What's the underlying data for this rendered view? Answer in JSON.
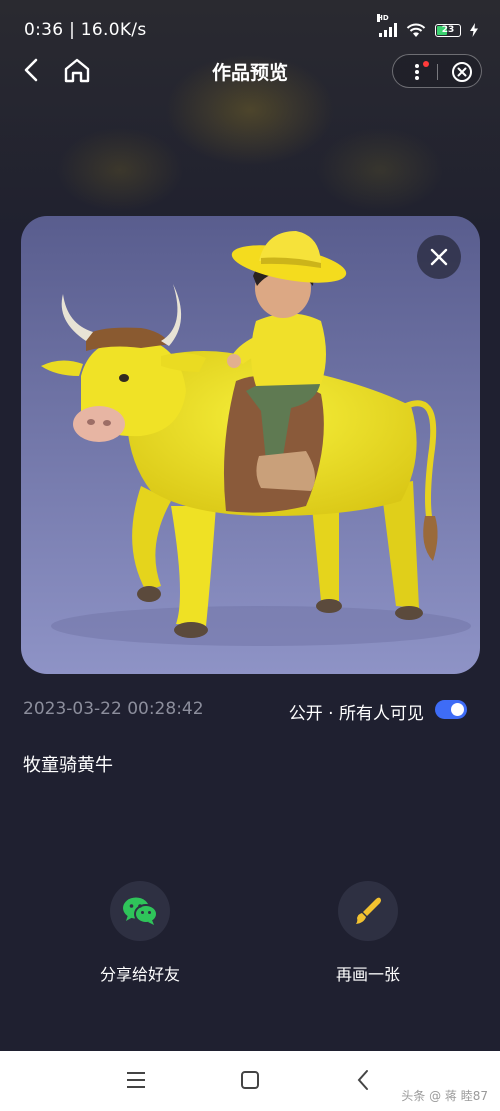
{
  "status_bar": {
    "time_speed": "0:36 | 16.0K/s",
    "signal_label": "HD",
    "battery": "23"
  },
  "header": {
    "title": "作品预览",
    "back_icon": "chevron-left-icon",
    "home_icon": "home-icon",
    "more_icon": "more-vertical-icon",
    "close_icon": "close-circle-icon"
  },
  "artwork": {
    "close_icon": "close-icon"
  },
  "meta": {
    "created_at": "2023-03-22 00:28:42",
    "visibility_label": "公开 · 所有人可见",
    "visibility_enabled": true,
    "toggle_color": "#3e6cf6"
  },
  "prompt_text": "牧童骑黄牛",
  "actions": {
    "share_label": "分享给好友",
    "share_icon": "wechat-icon",
    "share_icon_color": "#2fc45a",
    "redraw_label": "再画一张",
    "redraw_icon": "paintbrush-icon",
    "redraw_icon_color": "#f2c230"
  },
  "system_nav": {
    "menu_icon": "menu-icon",
    "home_icon": "square-home-icon",
    "back_icon": "back-icon",
    "watermark": "头条 @ 蒋 睦87"
  }
}
